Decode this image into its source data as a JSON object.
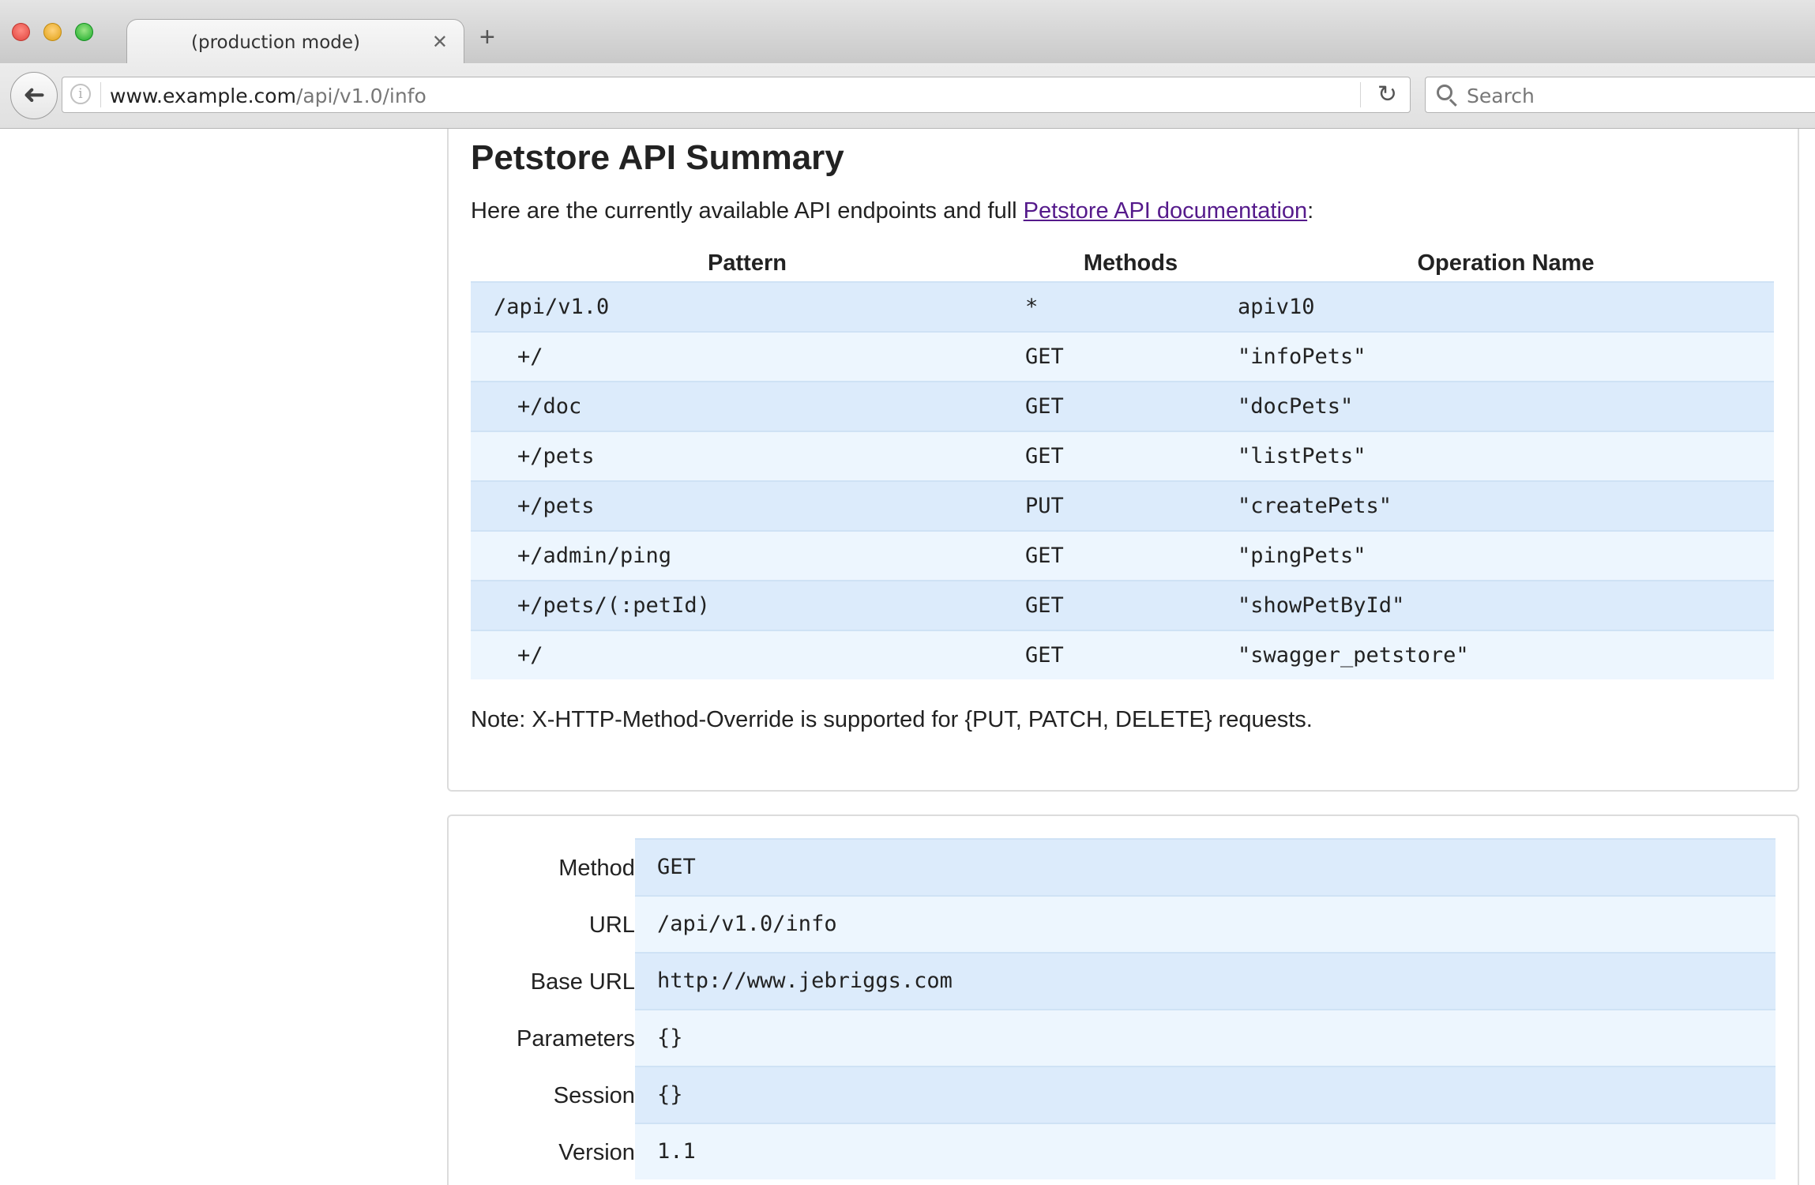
{
  "browser": {
    "tab_title": "(production mode)",
    "tab_close": "✕",
    "new_tab": "+",
    "url_host": "www.example.com",
    "url_path": "/api/v1.0/info",
    "search_placeholder": "Search",
    "back_icon": "➜",
    "reload_icon": "↻",
    "info_icon": "i"
  },
  "summary": {
    "title": "Petstore API Summary",
    "intro_prefix": "Here are the currently available API endpoints and full ",
    "doc_link": "Petstore API documentation",
    "intro_suffix": ":",
    "columns": [
      "Pattern",
      "Methods",
      "Operation Name"
    ],
    "rows": [
      {
        "pattern": "/api/v1.0",
        "method": "*",
        "operation": "apiv10"
      },
      {
        "pattern": "+/",
        "method": "GET",
        "operation": "\"infoPets\""
      },
      {
        "pattern": "+/doc",
        "method": "GET",
        "operation": "\"docPets\""
      },
      {
        "pattern": "+/pets",
        "method": "GET",
        "operation": "\"listPets\""
      },
      {
        "pattern": "+/pets",
        "method": "PUT",
        "operation": "\"createPets\""
      },
      {
        "pattern": "+/admin/ping",
        "method": "GET",
        "operation": "\"pingPets\""
      },
      {
        "pattern": "+/pets/(:petId)",
        "method": "GET",
        "operation": "\"showPetById\""
      },
      {
        "pattern": "+/",
        "method": "GET",
        "operation": "\"swagger_petstore\""
      }
    ],
    "note": "Note: X-HTTP-Method-Override is supported for {PUT, PATCH, DELETE} requests."
  },
  "request": {
    "fields": [
      {
        "label": "Method:",
        "value": "GET"
      },
      {
        "label": "URL:",
        "value": "/api/v1.0/info"
      },
      {
        "label": "Base URL:",
        "value": "http://www.jebriggs.com"
      },
      {
        "label": "Parameters:",
        "value": "{}"
      },
      {
        "label": "Session:",
        "value": "{}"
      },
      {
        "label": "Version:",
        "value": "1.1"
      }
    ]
  },
  "colors": {
    "row_dark": "#dcebfb",
    "row_light": "#edf6fe",
    "link": "#551a8b"
  }
}
